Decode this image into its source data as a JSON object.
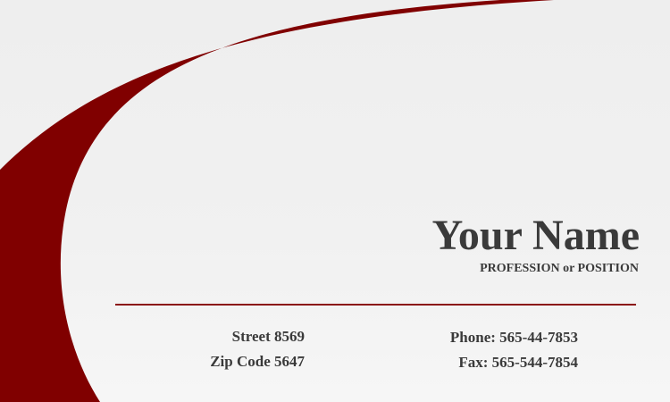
{
  "colors": {
    "accent": "#800000",
    "text": "#3a3a3a",
    "background": "#efefef"
  },
  "card": {
    "name": "Your Name",
    "position": "PROFESSION or POSITION",
    "address": {
      "street": "Street 8569",
      "zip": "Zip Code 5647"
    },
    "contact": {
      "phone": "Phone: 565-44-7853",
      "fax": "Fax: 565-544-7854"
    }
  }
}
